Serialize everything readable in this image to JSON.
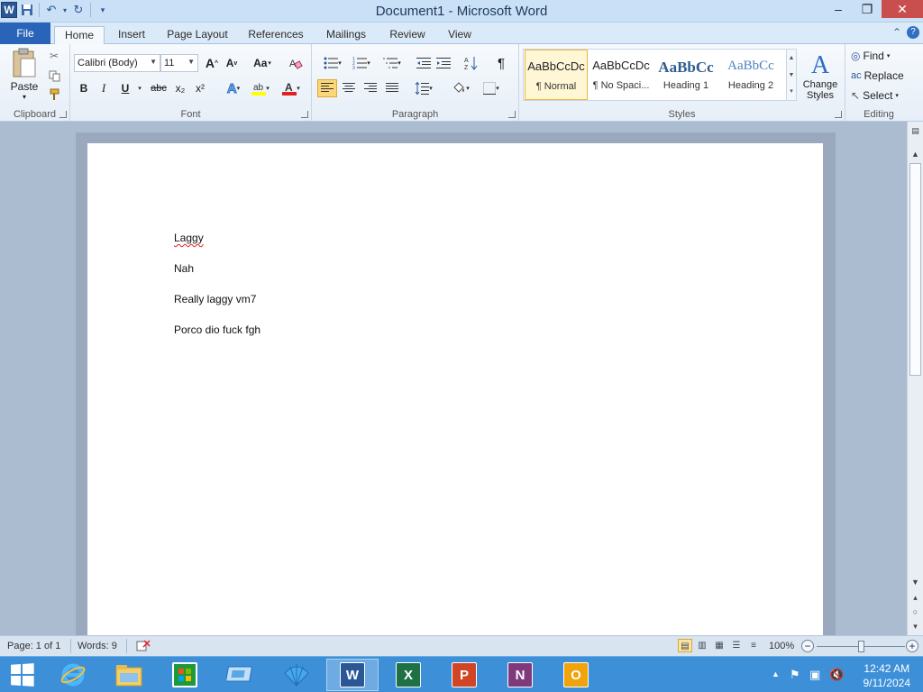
{
  "window": {
    "title": "Document1  -  Microsoft Word",
    "app_letter": "W",
    "controls": {
      "minimize": "–",
      "maximize": "❐",
      "close": "✕"
    }
  },
  "ribbon_tabs": [
    "File",
    "Home",
    "Insert",
    "Page Layout",
    "References",
    "Mailings",
    "Review",
    "View"
  ],
  "clipboard": {
    "paste_label": "Paste",
    "group_label": "Clipboard"
  },
  "font": {
    "family": "Calibri (Body)",
    "size": "11",
    "grow": "A",
    "shrink": "A",
    "change_case": "Aa",
    "bold": "B",
    "italic": "I",
    "underline": "U",
    "strikethrough": "abc",
    "subscript": "x₂",
    "superscript": "x²",
    "group_label": "Font"
  },
  "paragraph": {
    "group_label": "Paragraph",
    "pilcrow": "¶"
  },
  "styles": {
    "group_label": "Styles",
    "items": [
      {
        "sample": "AaBbCcDc",
        "name": "¶ Normal"
      },
      {
        "sample": "AaBbCcDc",
        "name": "¶ No Spaci..."
      },
      {
        "sample": "AaBbCc",
        "name": "Heading 1"
      },
      {
        "sample": "AaBbCc",
        "name": "Heading 2"
      }
    ],
    "change_styles": "Change Styles"
  },
  "editing": {
    "find": "Find",
    "replace": "Replace",
    "select": "Select",
    "group_label": "Editing"
  },
  "document": {
    "paragraphs": [
      "Laggy",
      "Nah",
      "Really laggy vm7",
      "Porco dio fuck fgh"
    ]
  },
  "status": {
    "page": "Page: 1 of 1",
    "words": "Words: 9",
    "zoom": "100%"
  },
  "taskbar": {
    "time": "12:42 AM",
    "date": "9/11/2024"
  },
  "colors": {
    "accent": "#2b5797",
    "file_tab": "#2a64b8",
    "taskbar": "#3d8fd8",
    "spell_error": "#e02020"
  }
}
